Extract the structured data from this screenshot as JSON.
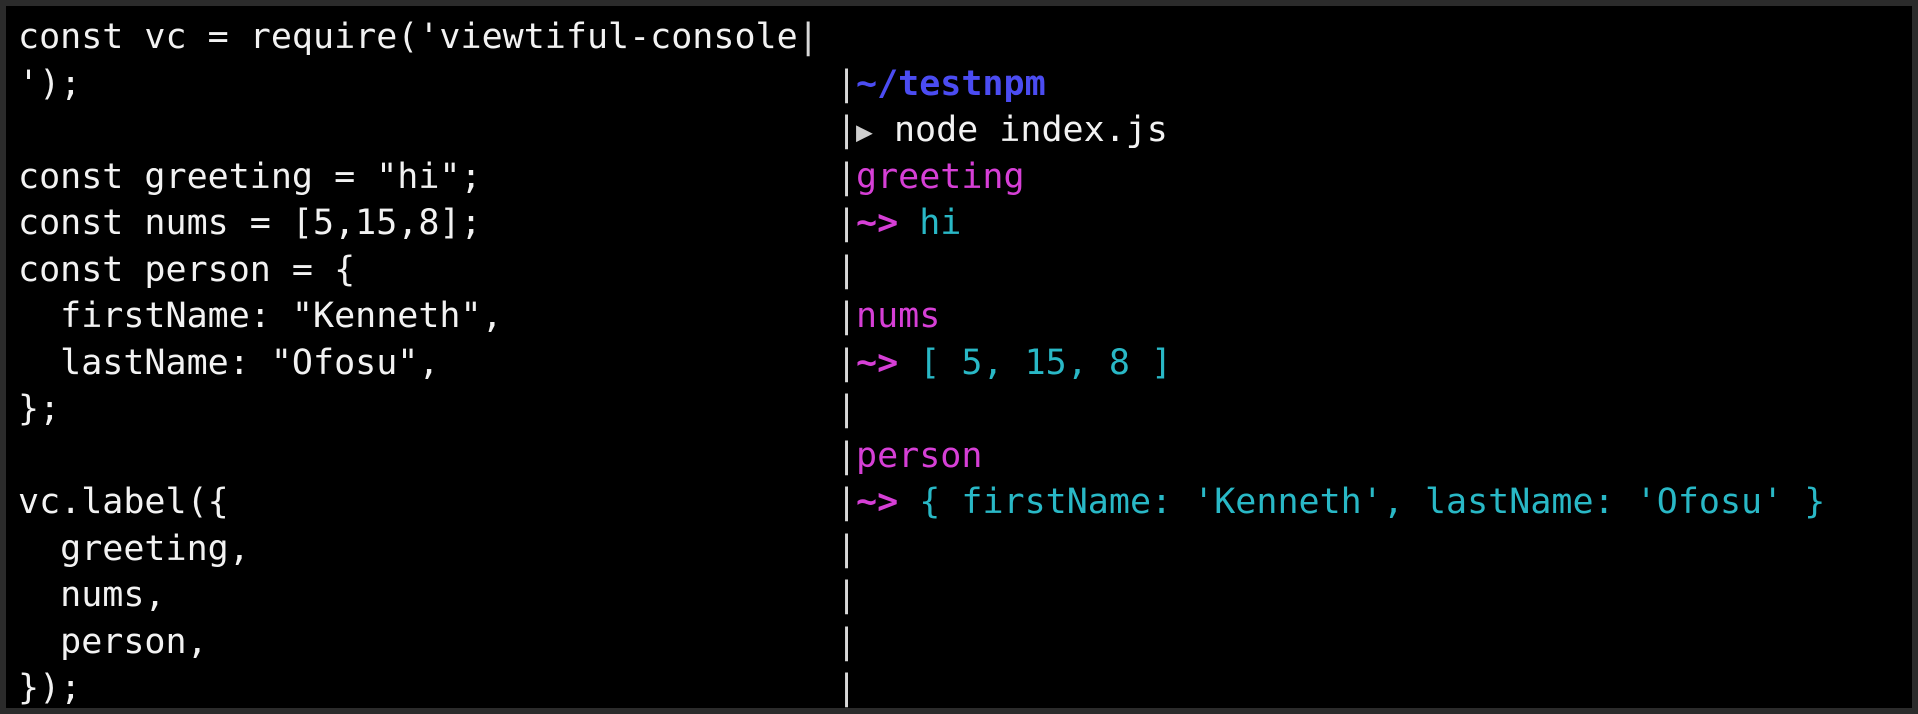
{
  "editor": {
    "lines": [
      "const vc = require('viewtiful-console",
      "');",
      "",
      "const greeting = \"hi\";",
      "const nums = [5,15,8];",
      "const person = {",
      "  firstName: \"Kenneth\",",
      "  lastName: \"Ofosu\",",
      "};",
      "",
      "vc.label({",
      "  greeting,",
      "  nums,",
      "  person,",
      "});"
    ],
    "cursor": "|"
  },
  "divider": {
    "char": "|"
  },
  "terminal": {
    "cwd": "~/testnpm",
    "prompt_symbol": "▶",
    "command": "node index.js",
    "arrow": "~>",
    "outputs": [
      {
        "label": "greeting",
        "value": "hi"
      },
      {
        "label": "nums",
        "value": "[ 5, 15, 8 ]"
      },
      {
        "label": "person",
        "value": "{ firstName: 'Kenneth', lastName: 'Ofosu' }"
      }
    ]
  },
  "colors": {
    "background": "#000000",
    "cwd": "#4b4cf2",
    "label": "#d63fd6",
    "value": "#29b8c6",
    "text": "#f2f2f2"
  }
}
